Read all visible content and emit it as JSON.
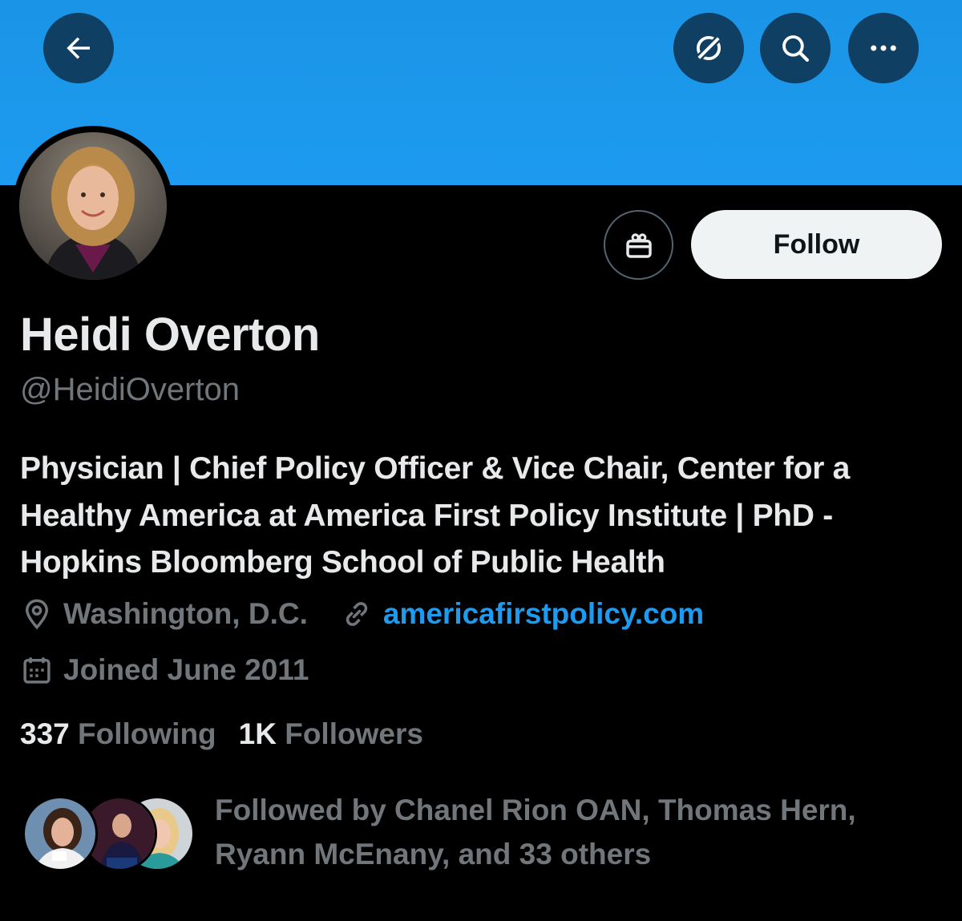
{
  "header": {
    "back_icon": "arrow-left-icon",
    "grok_icon": "grok-icon",
    "search_icon": "search-icon",
    "more_icon": "more-horizontal-icon",
    "banner_color": "#1d9bf0"
  },
  "profile": {
    "name": "Heidi Overton",
    "handle": "@HeidiOverton",
    "bio": "Physician | Chief Policy Officer & Vice Chair, Center for a Healthy America at America First Policy Institute | PhD - Hopkins Bloomberg School of Public Health",
    "location": "Washington, D.C.",
    "website": "americafirstpolicy.com",
    "joined": "Joined June 2011"
  },
  "actions": {
    "gift_icon": "gift-icon",
    "follow_label": "Follow"
  },
  "stats": {
    "following_count": "337",
    "following_label": "Following",
    "followers_count": "1K",
    "followers_label": "Followers"
  },
  "followed_by": {
    "text": "Followed by Chanel Rion OAN, Thomas Hern, Ryann McEnany, and 33 others"
  },
  "colors": {
    "accent": "#1d9bf0",
    "muted": "#71767b",
    "text": "#e7e9ea",
    "background": "#000000"
  }
}
